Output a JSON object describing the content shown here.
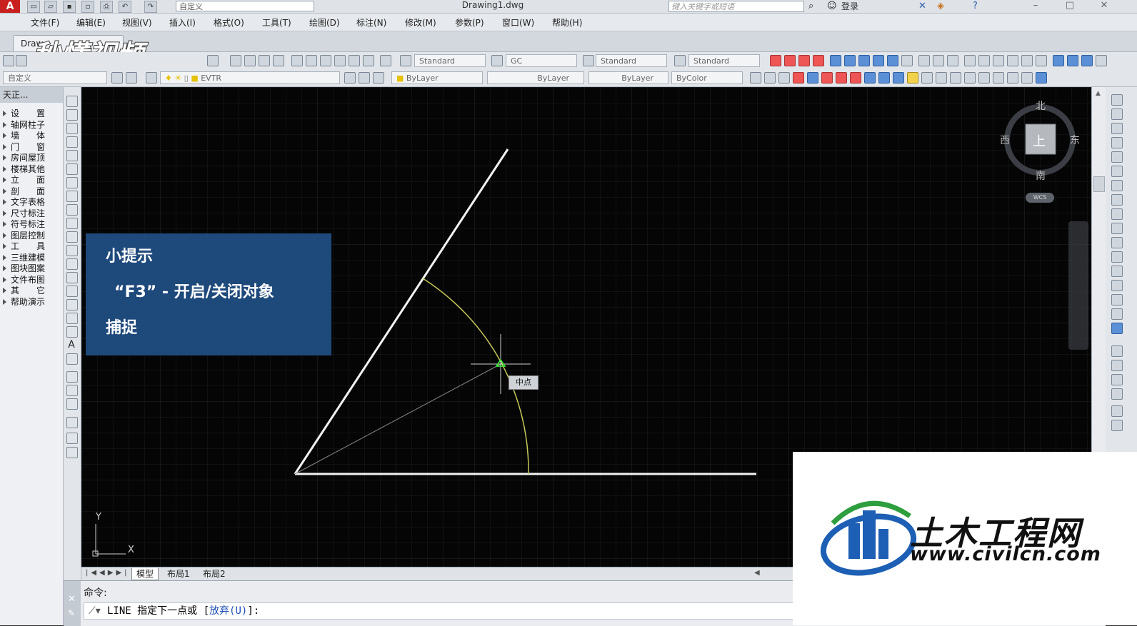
{
  "titlebar": {
    "app_logo": "A",
    "workspace": "自定义",
    "document_title": "Drawing1.dwg",
    "search_placeholder": "键入关键字或短语",
    "login": "登录"
  },
  "menu": [
    "文件(F)",
    "编辑(E)",
    "视图(V)",
    "插入(I)",
    "格式(O)",
    "工具(T)",
    "绘图(D)",
    "标注(N)",
    "修改(M)",
    "参数(P)",
    "窗口(W)",
    "帮助(H)"
  ],
  "tab": {
    "doc_tab": "Draw"
  },
  "watermark_top": "秒懂视频",
  "toolbar1": {
    "text_style": "Standard",
    "dim_style": "GC",
    "table_style": "Standard",
    "multileader_style": "Standard"
  },
  "toolbar2": {
    "workspace": "自定义",
    "layer": "EVTR",
    "color": "ByLayer",
    "linetype": "ByLayer",
    "lineweight": "ByLayer",
    "plot_style": "ByColor"
  },
  "left_panel": {
    "title": "天正...",
    "items": [
      "设　　置",
      "轴网柱子",
      "墙　　体",
      "门　　窗",
      "房间屋顶",
      "楼梯其他",
      "立　　面",
      "剖　　面",
      "文字表格",
      "尺寸标注",
      "符号标注",
      "图层控制",
      "工　　具",
      "三维建模",
      "图块图案",
      "文件布图",
      "其　　它",
      "帮助演示"
    ]
  },
  "tip": {
    "title": "小提示",
    "line1": "“F3” - 开启/关闭对象",
    "line2": "捕捉"
  },
  "compass": {
    "north": "北",
    "south": "南",
    "east": "东",
    "west": "西",
    "top": "上",
    "wcs": "WCS"
  },
  "snap_tooltip": "中点",
  "ucs": {
    "x": "X",
    "y": "Y"
  },
  "layout_tabs": [
    "模型",
    "布局1",
    "布局2"
  ],
  "command": {
    "history": "命令:",
    "prompt_prefix": "LINE 指定下一点或 [",
    "option": "放弃(U)",
    "prompt_suffix": "]:"
  },
  "logo": {
    "name": "土木工程网",
    "url": "www.civilcn.com"
  },
  "colors": {
    "tip_bg": "#1e497b",
    "canvas_bg": "#050505",
    "snap_marker": "#3cff3c",
    "arc": "#c8c85a"
  }
}
